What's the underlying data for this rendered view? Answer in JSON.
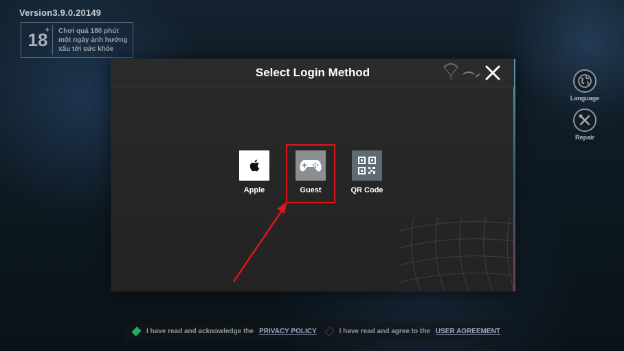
{
  "app": {
    "version": "Version3.9.0.20149"
  },
  "age_rating": {
    "number": "18",
    "plus": "+",
    "lines": [
      "Chơi quá 180 phút",
      "một ngày ảnh hưởng",
      "xấu tới sức khỏe"
    ]
  },
  "side_buttons": [
    {
      "label": "Language",
      "icon": "globe-icon"
    },
    {
      "label": "Repair",
      "icon": "wrench-screwdriver-icon"
    }
  ],
  "dialog": {
    "title": "Select Login Method",
    "close_icon": "close-icon",
    "methods": [
      {
        "label": "Apple",
        "icon": "apple-icon",
        "tile_color": "#ffffff"
      },
      {
        "label": "Guest",
        "icon": "gamepad-icon",
        "tile_color": "#8a8f94",
        "highlighted": true
      },
      {
        "label": "QR Code",
        "icon": "qr-code-icon",
        "tile_color": "#5e6b73"
      }
    ]
  },
  "footer": {
    "privacy_prefix": "I have read and acknowledge the",
    "privacy_link": "PRIVACY POLICY",
    "agreement_prefix": "I have read and agree to the",
    "agreement_link": "USER AGREEMENT",
    "privacy_checked": true,
    "agreement_checked": false
  },
  "colors": {
    "highlight": "#e0141b",
    "check_on": "#1fae62",
    "check_off": "#3a4045"
  }
}
